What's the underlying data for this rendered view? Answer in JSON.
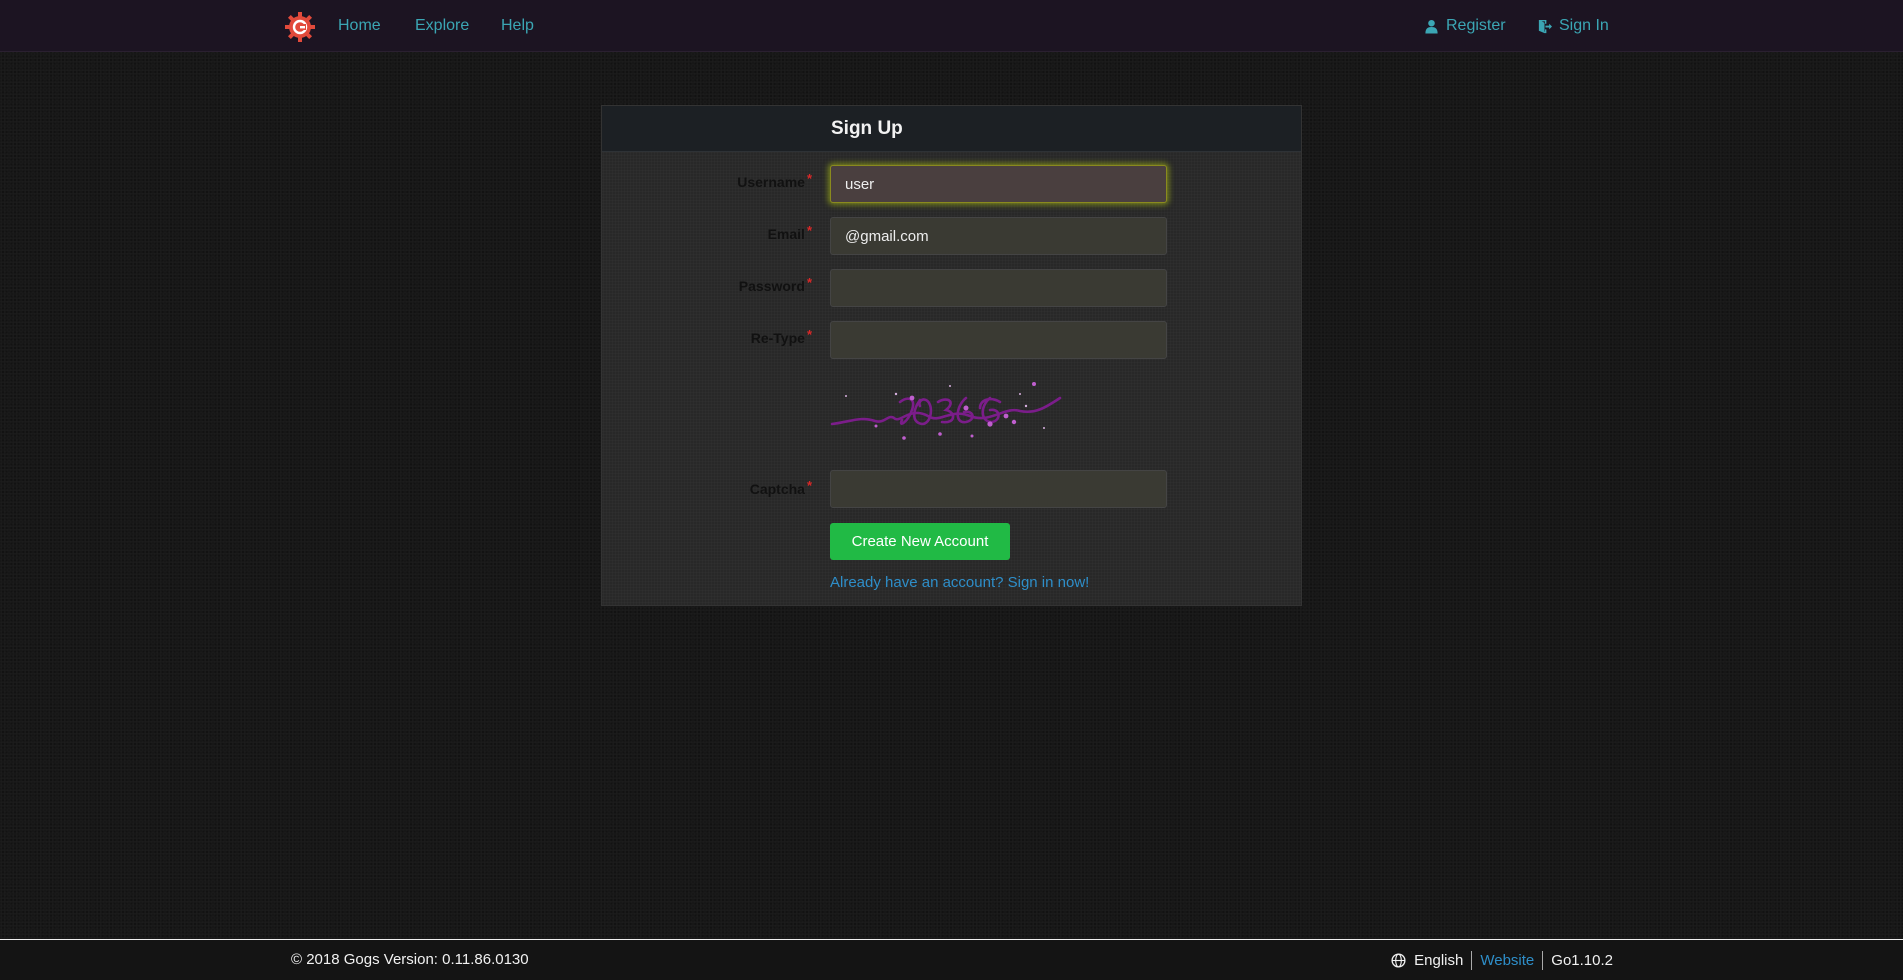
{
  "header": {
    "nav": [
      {
        "label": "Home"
      },
      {
        "label": "Explore"
      },
      {
        "label": "Help"
      }
    ],
    "register_label": "Register",
    "signin_label": "Sign In"
  },
  "form": {
    "title": "Sign Up",
    "fields": {
      "username": {
        "label": "Username",
        "value": "user"
      },
      "email": {
        "label": "Email",
        "value": "@gmail.com"
      },
      "password": {
        "label": "Password",
        "value": ""
      },
      "retype": {
        "label": "Re-Type",
        "value": ""
      },
      "captcha": {
        "label": "Captcha",
        "value": ""
      }
    },
    "required_mark": "*",
    "submit_label": "Create New Account",
    "signin_link": "Already have an account? Sign in now!"
  },
  "footer": {
    "copyright": "© 2018 Gogs Version: 0.11.86.0130",
    "language": "English",
    "website": "Website",
    "go_version": "Go1.10.2"
  },
  "colors": {
    "accent": "#3ba6b4",
    "button": "#21ba45",
    "link": "#2e8ec9",
    "required": "#db2828"
  },
  "icons": {
    "logo": "gogs-logo-icon",
    "register": "user-icon",
    "signin": "sign-in-icon",
    "language": "globe-icon"
  }
}
